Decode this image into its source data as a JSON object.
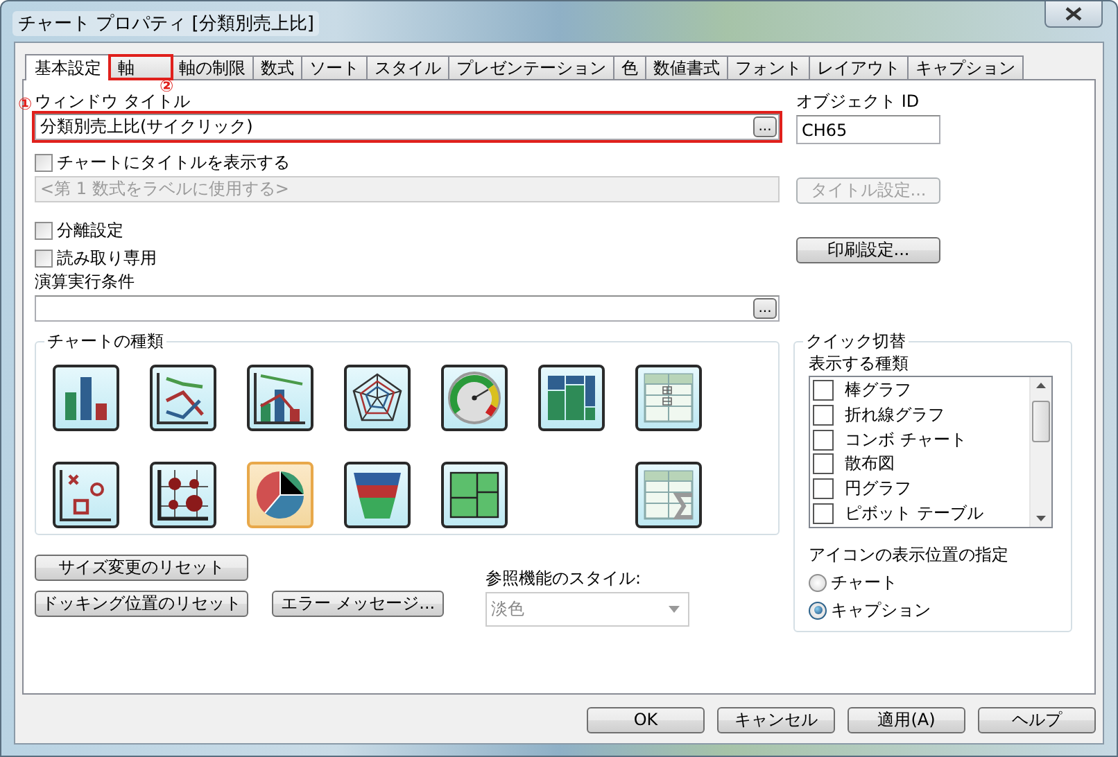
{
  "window": {
    "title": "チャート プロパティ [分類別売上比]"
  },
  "tabs": [
    {
      "label": "基本設定",
      "selected": true,
      "annotated": false
    },
    {
      "label": "軸",
      "selected": false,
      "annotated": true,
      "mark": "②"
    },
    {
      "label": "軸の制限",
      "selected": false,
      "annotated": false
    },
    {
      "label": "数式",
      "selected": false,
      "annotated": false
    },
    {
      "label": "ソート",
      "selected": false,
      "annotated": false
    },
    {
      "label": "スタイル",
      "selected": false,
      "annotated": false
    },
    {
      "label": "プレゼンテーション",
      "selected": false,
      "annotated": false
    },
    {
      "label": "色",
      "selected": false,
      "annotated": false
    },
    {
      "label": "数値書式",
      "selected": false,
      "annotated": false
    },
    {
      "label": "フォント",
      "selected": false,
      "annotated": false
    },
    {
      "label": "レイアウト",
      "selected": false,
      "annotated": false
    },
    {
      "label": "キャプション",
      "selected": false,
      "annotated": false
    }
  ],
  "window_title": {
    "label": "ウィンドウ タイトル",
    "mark": "①",
    "value": "分類別売上比(サイクリック)",
    "annotated": true,
    "button": "..."
  },
  "object_id": {
    "label": "オブジェクト ID",
    "value": "CH65"
  },
  "show_title": {
    "label": "チャートにタイトルを表示する",
    "checked": false
  },
  "title_field": {
    "placeholder": "<第 1 数式をラベルに使用する>",
    "disabled": true
  },
  "title_settings_button": {
    "label": "タイトル設定...",
    "disabled": true
  },
  "print_settings_button": {
    "label": "印刷設定...",
    "disabled": false
  },
  "options": [
    {
      "label": "分離設定",
      "checked": false
    },
    {
      "label": "読み取り専用",
      "checked": false
    }
  ],
  "condition": {
    "label": "演算実行条件",
    "button": "..."
  },
  "chart_types": {
    "title": "チャートの種類",
    "items": [
      {
        "kind": "bar",
        "selected": false
      },
      {
        "kind": "line",
        "selected": false
      },
      {
        "kind": "combo",
        "selected": false
      },
      {
        "kind": "radar",
        "selected": false
      },
      {
        "kind": "gauge",
        "selected": false
      },
      {
        "kind": "mekko",
        "selected": false
      },
      {
        "kind": "pivot",
        "selected": false
      },
      {
        "kind": "scatter",
        "selected": false
      },
      {
        "kind": "grid",
        "selected": false
      },
      {
        "kind": "pie",
        "selected": true
      },
      {
        "kind": "funnel",
        "selected": false
      },
      {
        "kind": "block",
        "selected": false
      },
      {
        "kind": "empty"
      },
      {
        "kind": "straight",
        "selected": false
      }
    ]
  },
  "quick_switch": {
    "title": "クイック切替",
    "list_label": "表示する種類",
    "items": [
      {
        "label": "棒グラフ",
        "checked": false
      },
      {
        "label": "折れ線グラフ",
        "checked": false
      },
      {
        "label": "コンボ チャート",
        "checked": false
      },
      {
        "label": "散布図",
        "checked": false
      },
      {
        "label": "円グラフ",
        "checked": false
      },
      {
        "label": "ピボット テーブル",
        "checked": false
      }
    ],
    "position_label": "アイコンの表示位置の指定",
    "positions": [
      {
        "label": "チャート",
        "selected": false
      },
      {
        "label": "キャプション",
        "selected": true
      }
    ]
  },
  "reset_buttons": [
    "サイズ変更のリセット",
    "ドッキング位置のリセット"
  ],
  "error_button": "エラー メッセージ...",
  "lookup_style": {
    "label": "参照機能のスタイル:",
    "value": "淡色",
    "disabled": true
  },
  "dialog_buttons": [
    "OK",
    "キャンセル",
    "適用(A)",
    "ヘルプ"
  ]
}
